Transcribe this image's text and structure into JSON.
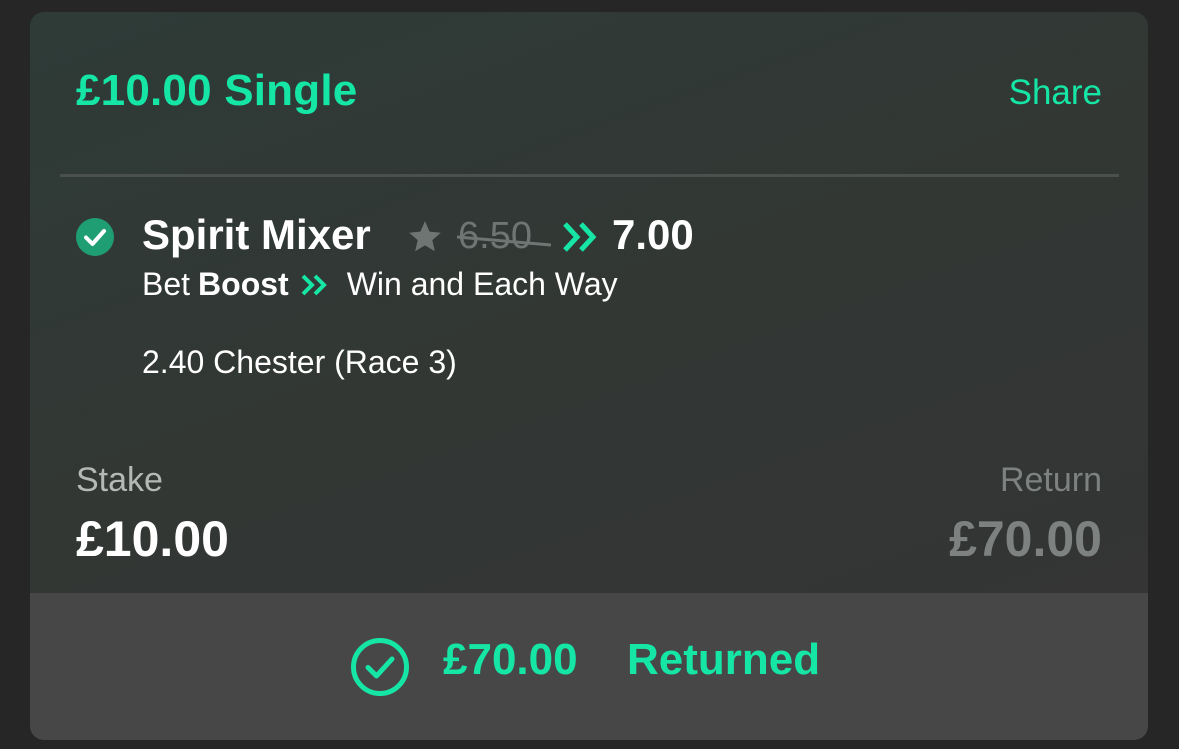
{
  "bet": {
    "title": "£10.00 Single",
    "share_label": "Share"
  },
  "selection": {
    "name": "Spirit Mixer",
    "old_odds": "6.50",
    "new_odds": "7.00",
    "boost_prefix": "Bet",
    "boost_word": "Boost",
    "market": "Win and Each Way",
    "event": "2.40 Chester (Race 3)",
    "icons": [
      "check-circle-icon",
      "star-icon",
      "double-chevron-right-icon"
    ]
  },
  "stake": {
    "label": "Stake",
    "value": "£10.00"
  },
  "return": {
    "label": "Return",
    "value": "£70.00"
  },
  "status": {
    "amount": "£70.00",
    "label": "Returned",
    "icon": "check-circle-outline-icon"
  },
  "colors": {
    "accent": "#15e6a6",
    "check_fill": "#1f9e73",
    "muted": "#7d8280",
    "background": "#262626"
  }
}
